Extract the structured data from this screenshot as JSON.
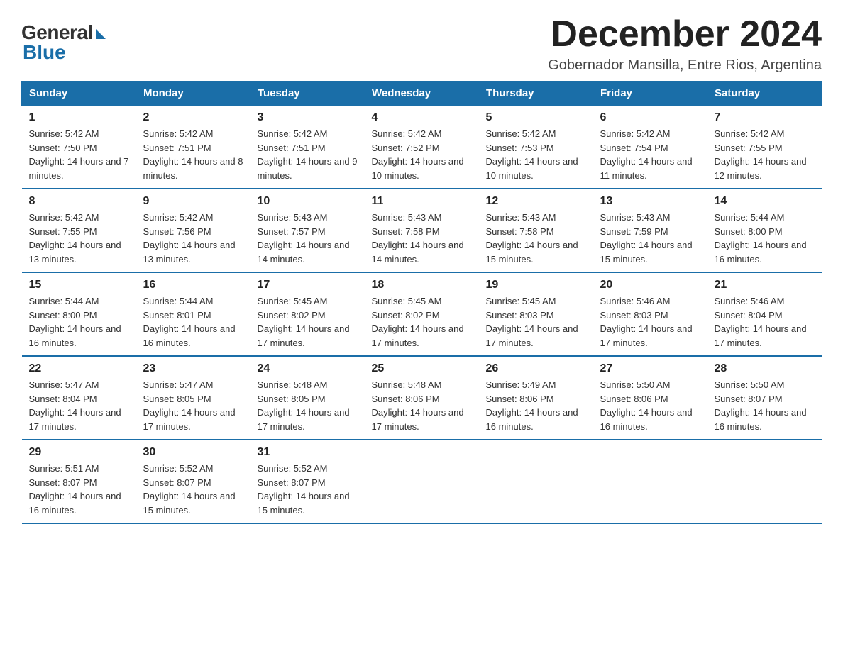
{
  "logo": {
    "general": "General",
    "blue": "Blue"
  },
  "title": "December 2024",
  "subtitle": "Gobernador Mansilla, Entre Rios, Argentina",
  "days_of_week": [
    "Sunday",
    "Monday",
    "Tuesday",
    "Wednesday",
    "Thursday",
    "Friday",
    "Saturday"
  ],
  "weeks": [
    [
      {
        "day": "1",
        "sunrise": "5:42 AM",
        "sunset": "7:50 PM",
        "daylight": "14 hours and 7 minutes."
      },
      {
        "day": "2",
        "sunrise": "5:42 AM",
        "sunset": "7:51 PM",
        "daylight": "14 hours and 8 minutes."
      },
      {
        "day": "3",
        "sunrise": "5:42 AM",
        "sunset": "7:51 PM",
        "daylight": "14 hours and 9 minutes."
      },
      {
        "day": "4",
        "sunrise": "5:42 AM",
        "sunset": "7:52 PM",
        "daylight": "14 hours and 10 minutes."
      },
      {
        "day": "5",
        "sunrise": "5:42 AM",
        "sunset": "7:53 PM",
        "daylight": "14 hours and 10 minutes."
      },
      {
        "day": "6",
        "sunrise": "5:42 AM",
        "sunset": "7:54 PM",
        "daylight": "14 hours and 11 minutes."
      },
      {
        "day": "7",
        "sunrise": "5:42 AM",
        "sunset": "7:55 PM",
        "daylight": "14 hours and 12 minutes."
      }
    ],
    [
      {
        "day": "8",
        "sunrise": "5:42 AM",
        "sunset": "7:55 PM",
        "daylight": "14 hours and 13 minutes."
      },
      {
        "day": "9",
        "sunrise": "5:42 AM",
        "sunset": "7:56 PM",
        "daylight": "14 hours and 13 minutes."
      },
      {
        "day": "10",
        "sunrise": "5:43 AM",
        "sunset": "7:57 PM",
        "daylight": "14 hours and 14 minutes."
      },
      {
        "day": "11",
        "sunrise": "5:43 AM",
        "sunset": "7:58 PM",
        "daylight": "14 hours and 14 minutes."
      },
      {
        "day": "12",
        "sunrise": "5:43 AM",
        "sunset": "7:58 PM",
        "daylight": "14 hours and 15 minutes."
      },
      {
        "day": "13",
        "sunrise": "5:43 AM",
        "sunset": "7:59 PM",
        "daylight": "14 hours and 15 minutes."
      },
      {
        "day": "14",
        "sunrise": "5:44 AM",
        "sunset": "8:00 PM",
        "daylight": "14 hours and 16 minutes."
      }
    ],
    [
      {
        "day": "15",
        "sunrise": "5:44 AM",
        "sunset": "8:00 PM",
        "daylight": "14 hours and 16 minutes."
      },
      {
        "day": "16",
        "sunrise": "5:44 AM",
        "sunset": "8:01 PM",
        "daylight": "14 hours and 16 minutes."
      },
      {
        "day": "17",
        "sunrise": "5:45 AM",
        "sunset": "8:02 PM",
        "daylight": "14 hours and 17 minutes."
      },
      {
        "day": "18",
        "sunrise": "5:45 AM",
        "sunset": "8:02 PM",
        "daylight": "14 hours and 17 minutes."
      },
      {
        "day": "19",
        "sunrise": "5:45 AM",
        "sunset": "8:03 PM",
        "daylight": "14 hours and 17 minutes."
      },
      {
        "day": "20",
        "sunrise": "5:46 AM",
        "sunset": "8:03 PM",
        "daylight": "14 hours and 17 minutes."
      },
      {
        "day": "21",
        "sunrise": "5:46 AM",
        "sunset": "8:04 PM",
        "daylight": "14 hours and 17 minutes."
      }
    ],
    [
      {
        "day": "22",
        "sunrise": "5:47 AM",
        "sunset": "8:04 PM",
        "daylight": "14 hours and 17 minutes."
      },
      {
        "day": "23",
        "sunrise": "5:47 AM",
        "sunset": "8:05 PM",
        "daylight": "14 hours and 17 minutes."
      },
      {
        "day": "24",
        "sunrise": "5:48 AM",
        "sunset": "8:05 PM",
        "daylight": "14 hours and 17 minutes."
      },
      {
        "day": "25",
        "sunrise": "5:48 AM",
        "sunset": "8:06 PM",
        "daylight": "14 hours and 17 minutes."
      },
      {
        "day": "26",
        "sunrise": "5:49 AM",
        "sunset": "8:06 PM",
        "daylight": "14 hours and 16 minutes."
      },
      {
        "day": "27",
        "sunrise": "5:50 AM",
        "sunset": "8:06 PM",
        "daylight": "14 hours and 16 minutes."
      },
      {
        "day": "28",
        "sunrise": "5:50 AM",
        "sunset": "8:07 PM",
        "daylight": "14 hours and 16 minutes."
      }
    ],
    [
      {
        "day": "29",
        "sunrise": "5:51 AM",
        "sunset": "8:07 PM",
        "daylight": "14 hours and 16 minutes."
      },
      {
        "day": "30",
        "sunrise": "5:52 AM",
        "sunset": "8:07 PM",
        "daylight": "14 hours and 15 minutes."
      },
      {
        "day": "31",
        "sunrise": "5:52 AM",
        "sunset": "8:07 PM",
        "daylight": "14 hours and 15 minutes."
      },
      null,
      null,
      null,
      null
    ]
  ],
  "labels": {
    "sunrise": "Sunrise:",
    "sunset": "Sunset:",
    "daylight": "Daylight:"
  }
}
